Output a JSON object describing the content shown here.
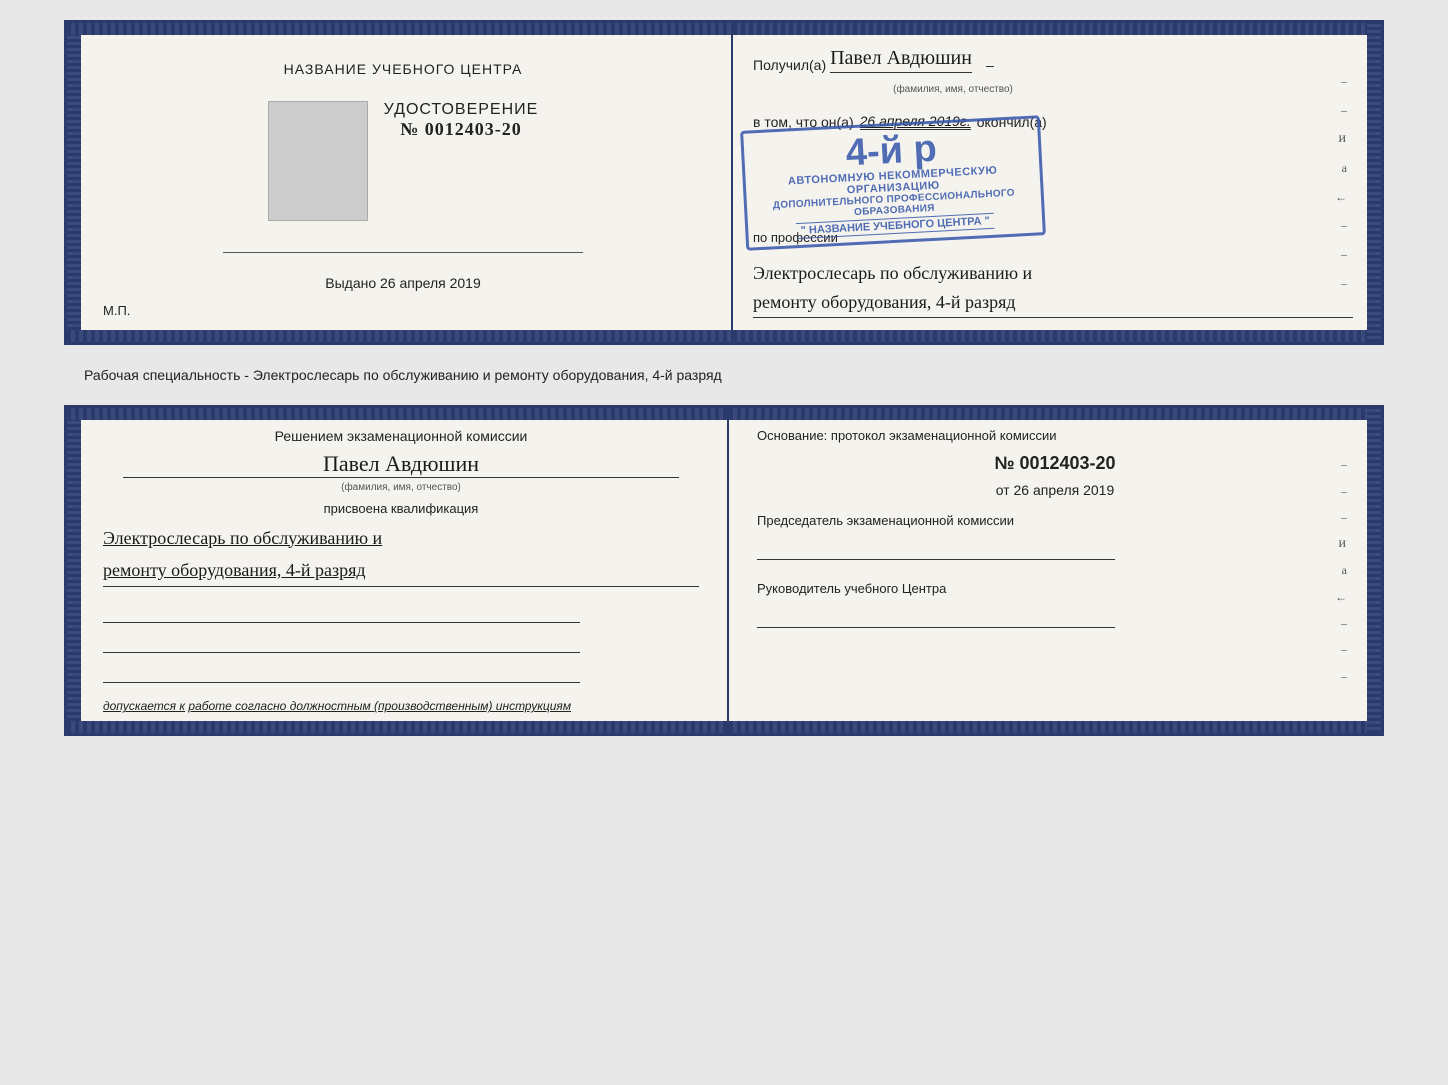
{
  "top_doc": {
    "left": {
      "center_title": "НАЗВАНИЕ УЧЕБНОГО ЦЕНТРА",
      "udostoverenie_label": "УДОСТОВЕРЕНИЕ",
      "number": "№ 0012403-20",
      "vydano_label": "Выдано",
      "vydano_date": "26 апреля 2019",
      "mp_label": "М.П."
    },
    "right": {
      "poluchil_label": "Получил(а)",
      "name_handwritten": "Павел Авдюшин",
      "fio_hint": "(фамилия, имя, отчество)",
      "dash": "–",
      "vtom_label": "в том, что он(а)",
      "date_handwritten": "26 апреля 2019г.",
      "okonchil_label": "окончил(а)",
      "stamp_line1": "АВТОНОМНУЮ НЕКОММЕРЧЕСКУЮ ОРГАНИЗАЦИЮ",
      "stamp_line2": "ДОПОЛНИТЕЛЬНОГО ПРОФЕССИОНАЛЬНОГО ОБРАЗОВАНИЯ",
      "stamp_center": "\" НАЗВАНИЕ УЧЕБНОГО ЦЕНТРА \"",
      "stamp_big": "4-й р",
      "po_professii": "по профессии",
      "profession_line1": "Электрослесарь по обслуживанию и",
      "profession_line2": "ремонту оборудования, 4-й разряд"
    }
  },
  "separator": {
    "text": "Рабочая специальность - Электрослесарь по обслуживанию и ремонту оборудования, 4-й разряд"
  },
  "bottom_doc": {
    "left": {
      "resheniem_label": "Решением экзаменационной  комиссии",
      "name_handwritten": "Павел Авдюшин",
      "fio_hint": "(фамилия, имя, отчество)",
      "prisvoena_label": "присвоена квалификация",
      "qualification_line1": "Электрослесарь по обслуживанию и",
      "qualification_line2": "ремонту оборудования, 4-й разряд",
      "dopuskaetsya_label": "допускается к",
      "dopuskaetsya_value": "работе согласно должностным (производственным) инструкциям"
    },
    "right": {
      "osnovanie_label": "Основание: протокол экзаменационной  комиссии",
      "protocol_number": "№  0012403-20",
      "ot_label": "от",
      "ot_date": "26 апреля 2019",
      "predsedatel_label": "Председатель экзаменационной комиссии",
      "rukovoditel_label": "Руководитель учебного Центра"
    }
  }
}
